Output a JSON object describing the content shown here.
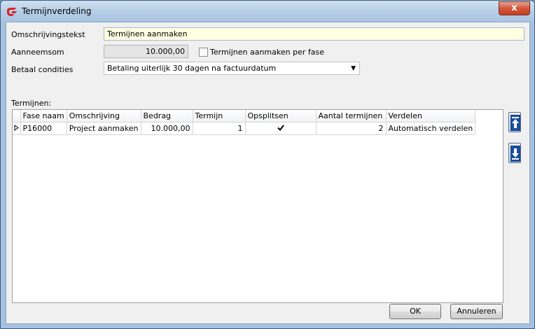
{
  "window": {
    "title": "Termijnverdeling",
    "close_label": "x"
  },
  "form": {
    "omschrijving_label": "Omschrijvingstekst",
    "omschrijving_value": "Termijnen aanmaken",
    "aanneemsom_label": "Aanneemsom",
    "aanneemsom_value": "10.000,00",
    "per_fase_label": "Termijnen aanmaken per fase",
    "per_fase_checked": false,
    "betaal_label": "Betaal condities",
    "betaal_value": "Betaling uiterlijk 30 dagen na factuurdatum"
  },
  "grid": {
    "label": "Termijnen:",
    "columns": [
      "Fase naam",
      "Omschrijving",
      "Bedrag",
      "Termijn",
      "Opsplitsen",
      "Aantal termijnen",
      "Verdelen"
    ],
    "rows": [
      {
        "fase": "P16000",
        "omschrijving": "Project aanmaken",
        "bedrag": "10.000,00",
        "termijn": "1",
        "opsplitsen": true,
        "aantal": "2",
        "verdelen": "Automatisch verdelen"
      }
    ]
  },
  "buttons": {
    "ok": "OK",
    "cancel": "Annuleren"
  },
  "icons": {
    "move_up": "arrow-up-icon",
    "move_down": "arrow-down-icon",
    "row_indicator": "row-pointer-icon",
    "check": "checkmark-icon"
  }
}
